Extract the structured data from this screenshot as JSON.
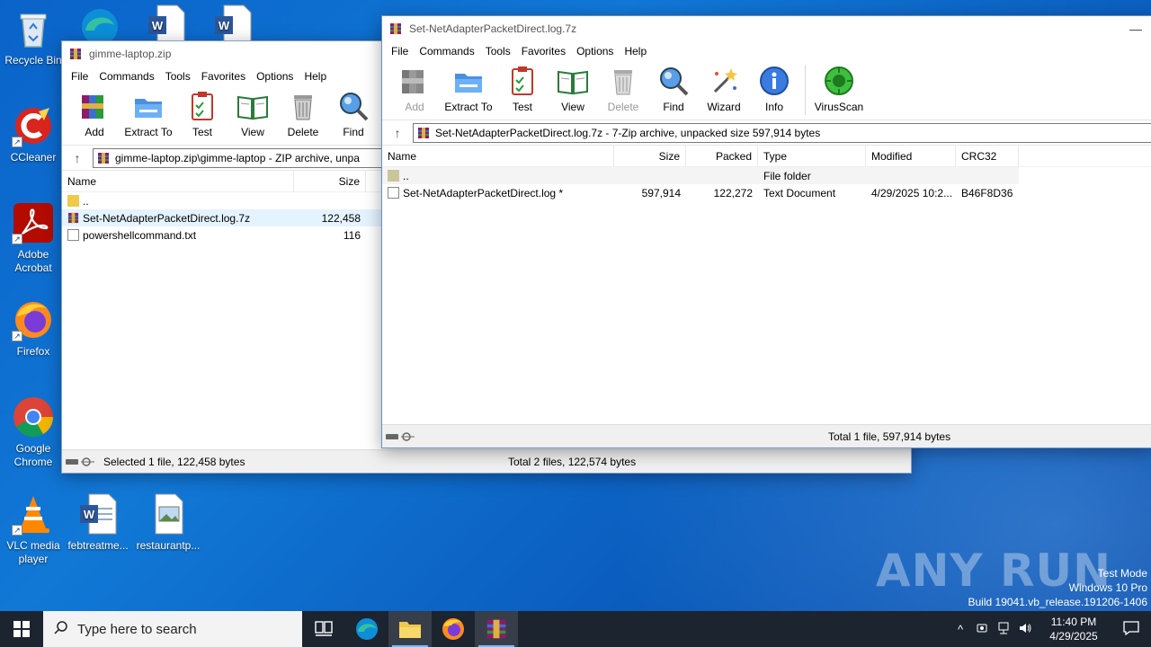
{
  "desktop": {
    "icons": [
      {
        "label": "Recycle Bin",
        "icon": "recycle-bin-icon"
      },
      {
        "label": "CCleaner",
        "icon": "ccleaner-icon"
      },
      {
        "label": "Adobe Acrobat",
        "icon": "acrobat-icon"
      },
      {
        "label": "Firefox",
        "icon": "firefox-icon"
      },
      {
        "label": "Google Chrome",
        "icon": "chrome-icon"
      },
      {
        "label": "VLC media player",
        "icon": "vlc-icon"
      },
      {
        "label": "febtreatme...",
        "icon": "word-doc-icon"
      },
      {
        "label": "restaurantp...",
        "icon": "image-file-icon"
      }
    ]
  },
  "window_zip": {
    "title": "gimme-laptop.zip",
    "menu": [
      "File",
      "Commands",
      "Tools",
      "Favorites",
      "Options",
      "Help"
    ],
    "toolbar": [
      "Add",
      "Extract To",
      "Test",
      "View",
      "Delete",
      "Find"
    ],
    "address": "gimme-laptop.zip\\gimme-laptop - ZIP archive, unpa",
    "columns": {
      "name": "Name",
      "size": "Size"
    },
    "rows": [
      {
        "name": "..",
        "size": "",
        "icon": "folder-icon"
      },
      {
        "name": "Set-NetAdapterPacketDirect.log.7z",
        "size": "122,458",
        "icon": "rar-archive-icon"
      },
      {
        "name": "powershellcommand.txt",
        "size": "116",
        "icon": "text-file-icon"
      }
    ],
    "status_left": "Selected 1 file, 122,458 bytes",
    "status_right": "Total 2 files, 122,574 bytes"
  },
  "window_7z": {
    "title": "Set-NetAdapterPacketDirect.log.7z",
    "minimize": "—",
    "menu": [
      "File",
      "Commands",
      "Tools",
      "Favorites",
      "Options",
      "Help"
    ],
    "toolbar": [
      "Add",
      "Extract To",
      "Test",
      "View",
      "Delete",
      "Find",
      "Wizard",
      "Info",
      "VirusScan"
    ],
    "address": "Set-NetAdapterPacketDirect.log.7z - 7-Zip archive, unpacked size 597,914 bytes",
    "columns": {
      "name": "Name",
      "size": "Size",
      "packed": "Packed",
      "type": "Type",
      "modified": "Modified",
      "crc": "CRC32"
    },
    "rows": [
      {
        "name": "..",
        "size": "",
        "packed": "",
        "type": "File folder",
        "modified": "",
        "crc": ""
      },
      {
        "name": "Set-NetAdapterPacketDirect.log *",
        "size": "597,914",
        "packed": "122,272",
        "type": "Text Document",
        "modified": "4/29/2025 10:2...",
        "crc": "B46F8D36"
      }
    ],
    "status_right": "Total 1 file, 597,914 bytes"
  },
  "taskbar": {
    "search_placeholder": "Type here to search",
    "time": "11:40 PM",
    "date": "4/29/2025"
  },
  "watermark": "ANY RUN",
  "system_info": {
    "line1": "Test Mode",
    "line2": "Windows 10 Pro",
    "line3": "Build 19041.vb_release.191206-1406"
  }
}
